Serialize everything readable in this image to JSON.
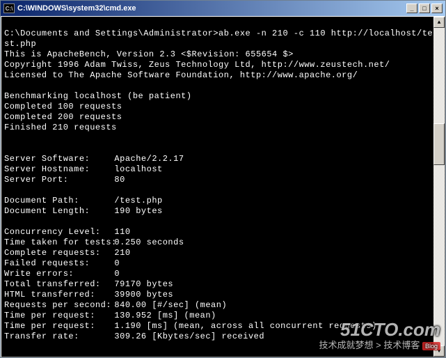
{
  "window": {
    "icon_label": "C:\\",
    "title": "C:\\WINDOWS\\system32\\cmd.exe"
  },
  "prompt": {
    "path": "C:\\Documents and Settings\\Administrator>",
    "command": "ab.exe -n 210 -c 110 http://localhost/te",
    "command_wrap": "st.php"
  },
  "header": {
    "line1": "This is ApacheBench, Version 2.3 <$Revision: 655654 $>",
    "line2": "Copyright 1996 Adam Twiss, Zeus Technology Ltd, http://www.zeustech.net/",
    "line3": "Licensed to The Apache Software Foundation, http://www.apache.org/"
  },
  "progress": {
    "bench": "Benchmarking localhost (be patient)",
    "c100": "Completed 100 requests",
    "c200": "Completed 200 requests",
    "fin": "Finished 210 requests"
  },
  "results": [
    {
      "label": "Server Software:",
      "value": "Apache/2.2.17"
    },
    {
      "label": "Server Hostname:",
      "value": "localhost"
    },
    {
      "label": "Server Port:",
      "value": "80"
    }
  ],
  "results2": [
    {
      "label": "Document Path:",
      "value": "/test.php"
    },
    {
      "label": "Document Length:",
      "value": "190 bytes"
    }
  ],
  "results3": [
    {
      "label": "Concurrency Level:",
      "value": "110"
    },
    {
      "label": "Time taken for tests:",
      "value": "0.250 seconds"
    },
    {
      "label": "Complete requests:",
      "value": "210"
    },
    {
      "label": "Failed requests:",
      "value": "0"
    },
    {
      "label": "Write errors:",
      "value": "0"
    },
    {
      "label": "Total transferred:",
      "value": "79170 bytes"
    },
    {
      "label": "HTML transferred:",
      "value": "39900 bytes"
    },
    {
      "label": "Requests per second:",
      "value": "840.00 [#/sec] (mean)"
    },
    {
      "label": "Time per request:",
      "value": "130.952 [ms] (mean)"
    },
    {
      "label": "Time per request:",
      "value": "1.190 [ms] (mean, across all concurrent requests)"
    },
    {
      "label": "Transfer rate:",
      "value": "309.26 [Kbytes/sec] received"
    }
  ],
  "watermark": {
    "main": "51CTO.com",
    "sub": "技术成就梦想 > 技术博客",
    "badge": "Blog"
  }
}
